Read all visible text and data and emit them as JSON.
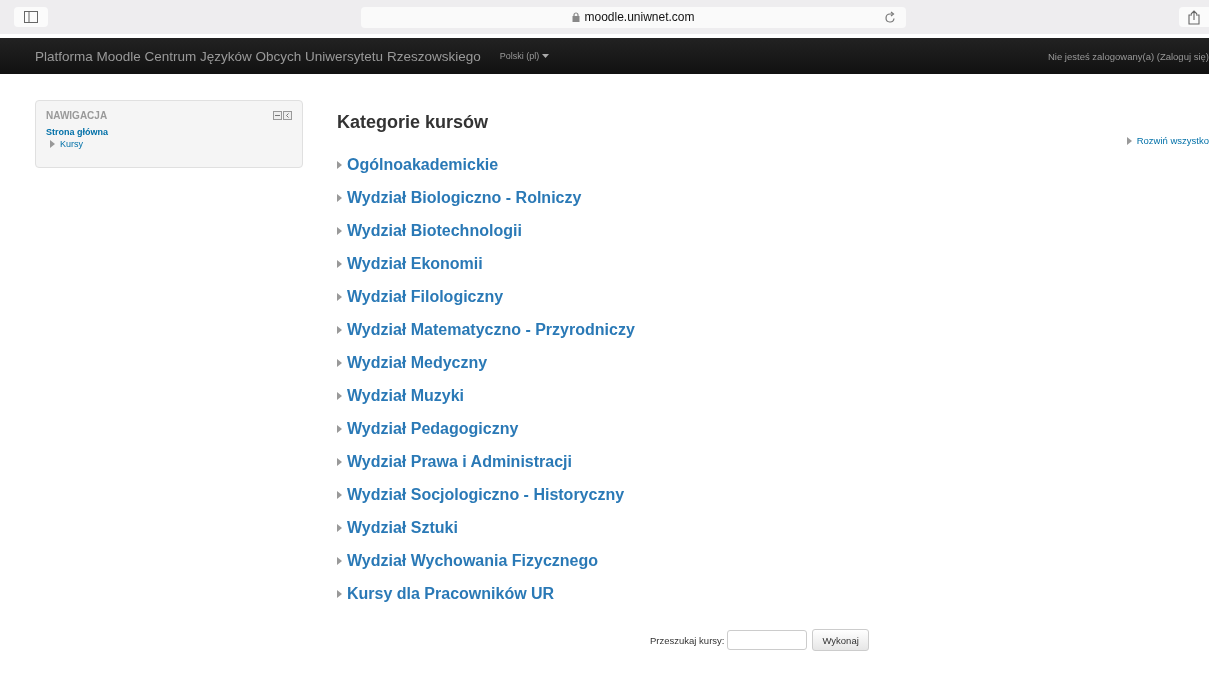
{
  "browser": {
    "address": "moodle.uniwnet.com"
  },
  "navbar": {
    "brand": "Platforma Moodle Centrum Języków Obcych Uniwersytetu Rzeszowskiego",
    "language": "Polski (pl)",
    "login_info": "Nie jesteś zalogowany(a) (Zaloguj się)"
  },
  "navigation_block": {
    "title": "NAWIGACJA",
    "items": [
      {
        "label": "Strona główna",
        "kind": "home"
      },
      {
        "label": "Kursy",
        "kind": "branch"
      }
    ]
  },
  "heading": "Kategorie kursów",
  "expand_all": "Rozwiń wszystko",
  "categories": [
    {
      "label": "Ogólnoakademickie"
    },
    {
      "label": "Wydział Biologiczno - Rolniczy"
    },
    {
      "label": "Wydział Biotechnologii"
    },
    {
      "label": "Wydział Ekonomii"
    },
    {
      "label": "Wydział Filologiczny"
    },
    {
      "label": "Wydział Matematyczno - Przyrodniczy"
    },
    {
      "label": "Wydział Medyczny"
    },
    {
      "label": "Wydział Muzyki"
    },
    {
      "label": "Wydział Pedagogiczny"
    },
    {
      "label": "Wydział Prawa i Administracji"
    },
    {
      "label": "Wydział Socjologiczno - Historyczny"
    },
    {
      "label": "Wydział Sztuki"
    },
    {
      "label": "Wydział Wychowania Fizycznego"
    },
    {
      "label": "Kursy dla Pracowników UR"
    }
  ],
  "search": {
    "label": "Przeszukaj kursy:",
    "button": "Wykonaj"
  }
}
